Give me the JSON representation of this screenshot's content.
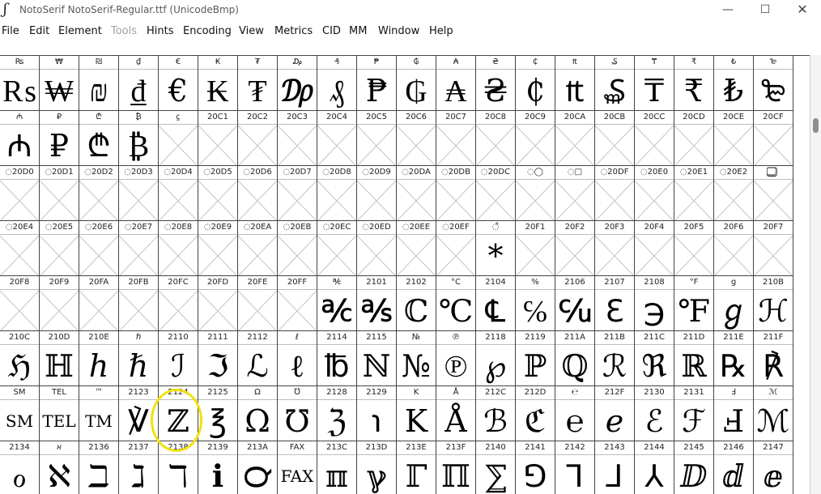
{
  "window": {
    "title": "NotoSerif  NotoSerif-Regular.ttf (UnicodeBmp)",
    "app_icon": "fontforge-icon",
    "minimize": "—",
    "maximize": "☐",
    "close": "✕"
  },
  "menu": [
    {
      "label": "File",
      "enabled": true
    },
    {
      "label": "Edit",
      "enabled": true
    },
    {
      "label": "Element",
      "enabled": true
    },
    {
      "label": "Tools",
      "enabled": false
    },
    {
      "label": "Hints",
      "enabled": true
    },
    {
      "label": "Encoding",
      "enabled": true
    },
    {
      "label": "View",
      "enabled": true
    },
    {
      "label": "Metrics",
      "enabled": true
    },
    {
      "label": "CID",
      "enabled": true
    },
    {
      "label": "MM",
      "enabled": true
    },
    {
      "label": "Window",
      "enabled": true
    },
    {
      "label": "Help",
      "enabled": true
    }
  ],
  "rows": [
    {
      "cells": [
        {
          "label": "₨",
          "glyph": "₨"
        },
        {
          "label": "₩",
          "glyph": "₩"
        },
        {
          "label": "₪",
          "glyph": "₪"
        },
        {
          "label": "₫",
          "glyph": "₫"
        },
        {
          "label": "€",
          "glyph": "€"
        },
        {
          "label": "₭",
          "glyph": "₭"
        },
        {
          "label": "₮",
          "glyph": "₮"
        },
        {
          "label": "₯",
          "glyph": "₯"
        },
        {
          "label": "₰",
          "glyph": "₰"
        },
        {
          "label": "₱",
          "glyph": "₱"
        },
        {
          "label": "₲",
          "glyph": "₲"
        },
        {
          "label": "₳",
          "glyph": "₳"
        },
        {
          "label": "₴",
          "glyph": "₴"
        },
        {
          "label": "₵",
          "glyph": "₵"
        },
        {
          "label": "₶",
          "glyph": "₶"
        },
        {
          "label": "₷",
          "glyph": "₷"
        },
        {
          "label": "₸",
          "glyph": "₸"
        },
        {
          "label": "₹",
          "glyph": "₹"
        },
        {
          "label": "₺",
          "glyph": "₺"
        },
        {
          "label": "₻",
          "glyph": "₻"
        }
      ]
    },
    {
      "cells": [
        {
          "label": "₼",
          "glyph": "₼"
        },
        {
          "label": "₽",
          "glyph": "₽"
        },
        {
          "label": "₾",
          "glyph": "₾"
        },
        {
          "label": "₿",
          "glyph": "₿"
        },
        {
          "label": "⃀",
          "glyph": ""
        },
        {
          "label": "20C1",
          "glyph": ""
        },
        {
          "label": "20C2",
          "glyph": ""
        },
        {
          "label": "20C3",
          "glyph": ""
        },
        {
          "label": "20C4",
          "glyph": ""
        },
        {
          "label": "20C5",
          "glyph": ""
        },
        {
          "label": "20C6",
          "glyph": ""
        },
        {
          "label": "20C7",
          "glyph": ""
        },
        {
          "label": "20C8",
          "glyph": ""
        },
        {
          "label": "20C9",
          "glyph": ""
        },
        {
          "label": "20CA",
          "glyph": ""
        },
        {
          "label": "20CB",
          "glyph": ""
        },
        {
          "label": "20CC",
          "glyph": ""
        },
        {
          "label": "20CD",
          "glyph": ""
        },
        {
          "label": "20CE",
          "glyph": ""
        },
        {
          "label": "20CF",
          "glyph": ""
        }
      ]
    },
    {
      "cells": [
        {
          "label": "◌20D0",
          "glyph": ""
        },
        {
          "label": "◌20D1",
          "glyph": ""
        },
        {
          "label": "◌20D2",
          "glyph": ""
        },
        {
          "label": "◌20D3",
          "glyph": ""
        },
        {
          "label": "◌20D4",
          "glyph": ""
        },
        {
          "label": "◌20D5",
          "glyph": ""
        },
        {
          "label": "◌20D6",
          "glyph": ""
        },
        {
          "label": "◌20D7",
          "glyph": ""
        },
        {
          "label": "◌20D8",
          "glyph": ""
        },
        {
          "label": "◌20D9",
          "glyph": ""
        },
        {
          "label": "◌20DA",
          "glyph": ""
        },
        {
          "label": "◌20DB",
          "glyph": ""
        },
        {
          "label": "◌20DC",
          "glyph": ""
        },
        {
          "label": "◌◯",
          "glyph": ""
        },
        {
          "label": "◌□",
          "glyph": ""
        },
        {
          "label": "◌20DF",
          "glyph": ""
        },
        {
          "label": "◌20E0",
          "glyph": ""
        },
        {
          "label": "◌20E1",
          "glyph": ""
        },
        {
          "label": "◌20E2",
          "glyph": ""
        },
        {
          "label": "⃣",
          "glyph": ""
        }
      ]
    },
    {
      "cells": [
        {
          "label": "◌20E4",
          "glyph": ""
        },
        {
          "label": "◌20E5",
          "glyph": ""
        },
        {
          "label": "◌20E6",
          "glyph": ""
        },
        {
          "label": "◌20E7",
          "glyph": ""
        },
        {
          "label": "◌20E8",
          "glyph": ""
        },
        {
          "label": "◌20E9",
          "glyph": ""
        },
        {
          "label": "◌20EA",
          "glyph": ""
        },
        {
          "label": "◌20EB",
          "glyph": ""
        },
        {
          "label": "◌20EC",
          "glyph": ""
        },
        {
          "label": "◌20ED",
          "glyph": ""
        },
        {
          "label": "◌20EE",
          "glyph": ""
        },
        {
          "label": "◌20EF",
          "glyph": ""
        },
        {
          "label": "◌̊",
          "glyph": "*"
        },
        {
          "label": "20F1",
          "glyph": ""
        },
        {
          "label": "20F2",
          "glyph": ""
        },
        {
          "label": "20F3",
          "glyph": ""
        },
        {
          "label": "20F4",
          "glyph": ""
        },
        {
          "label": "20F5",
          "glyph": ""
        },
        {
          "label": "20F6",
          "glyph": ""
        },
        {
          "label": "20F7",
          "glyph": ""
        }
      ]
    },
    {
      "cells": [
        {
          "label": "20F8",
          "glyph": ""
        },
        {
          "label": "20F9",
          "glyph": ""
        },
        {
          "label": "20FA",
          "glyph": ""
        },
        {
          "label": "20FB",
          "glyph": ""
        },
        {
          "label": "20FC",
          "glyph": ""
        },
        {
          "label": "20FD",
          "glyph": ""
        },
        {
          "label": "20FE",
          "glyph": ""
        },
        {
          "label": "20FF",
          "glyph": ""
        },
        {
          "label": "℀",
          "glyph": "℀"
        },
        {
          "label": "2101",
          "glyph": "℁"
        },
        {
          "label": "2102",
          "glyph": "ℂ"
        },
        {
          "label": "°C",
          "glyph": "℃"
        },
        {
          "label": "2104",
          "glyph": "℄"
        },
        {
          "label": "%",
          "glyph": "℅"
        },
        {
          "label": "2106",
          "glyph": "℆"
        },
        {
          "label": "2107",
          "glyph": "ℇ"
        },
        {
          "label": "2108",
          "glyph": "℈"
        },
        {
          "label": "°F",
          "glyph": "℉"
        },
        {
          "label": "g",
          "glyph": "ℊ"
        },
        {
          "label": "210B",
          "glyph": "ℋ"
        }
      ]
    },
    {
      "cells": [
        {
          "label": "210C",
          "glyph": "ℌ"
        },
        {
          "label": "210D",
          "glyph": "ℍ"
        },
        {
          "label": "210E",
          "glyph": "ℎ"
        },
        {
          "label": "ℏ",
          "glyph": "ℏ"
        },
        {
          "label": "2110",
          "glyph": "ℐ"
        },
        {
          "label": "2111",
          "glyph": "ℑ"
        },
        {
          "label": "2112",
          "glyph": "ℒ"
        },
        {
          "label": "ℓ",
          "glyph": "ℓ"
        },
        {
          "label": "2114",
          "glyph": "℔"
        },
        {
          "label": "2115",
          "glyph": "ℕ"
        },
        {
          "label": "№",
          "glyph": "№"
        },
        {
          "label": "℗",
          "glyph": "℗"
        },
        {
          "label": "2118",
          "glyph": "℘"
        },
        {
          "label": "2119",
          "glyph": "ℙ"
        },
        {
          "label": "211A",
          "glyph": "ℚ"
        },
        {
          "label": "211B",
          "glyph": "ℛ"
        },
        {
          "label": "211C",
          "glyph": "ℜ"
        },
        {
          "label": "211D",
          "glyph": "ℝ"
        },
        {
          "label": "211E",
          "glyph": "℞"
        },
        {
          "label": "211F",
          "glyph": "℟"
        }
      ]
    },
    {
      "cells": [
        {
          "label": "SM",
          "glyph": "SM"
        },
        {
          "label": "TEL",
          "glyph": "TEL"
        },
        {
          "label": "™",
          "glyph": "TM"
        },
        {
          "label": "2123",
          "glyph": "℣"
        },
        {
          "label": "2124",
          "glyph": "ℤ"
        },
        {
          "label": "2125",
          "glyph": "℥"
        },
        {
          "label": "Ω",
          "glyph": "Ω"
        },
        {
          "label": "℧",
          "glyph": "℧"
        },
        {
          "label": "2128",
          "glyph": "ℨ"
        },
        {
          "label": "2129",
          "glyph": "℩"
        },
        {
          "label": "K",
          "glyph": "K"
        },
        {
          "label": "Å",
          "glyph": "Å"
        },
        {
          "label": "212C",
          "glyph": "ℬ"
        },
        {
          "label": "212D",
          "glyph": "ℭ"
        },
        {
          "label": "℮",
          "glyph": "℮"
        },
        {
          "label": "212F",
          "glyph": "ℯ"
        },
        {
          "label": "2130",
          "glyph": "ℰ"
        },
        {
          "label": "2131",
          "glyph": "ℱ"
        },
        {
          "label": "Ⅎ",
          "glyph": "Ⅎ"
        },
        {
          "label": "ℳ",
          "glyph": "ℳ"
        }
      ]
    },
    {
      "cells": [
        {
          "label": "2134",
          "glyph": "ℴ"
        },
        {
          "label": "א",
          "glyph": "ℵ"
        },
        {
          "label": "2136",
          "glyph": "ℶ"
        },
        {
          "label": "2137",
          "glyph": "ℷ"
        },
        {
          "label": "2138",
          "glyph": "ℸ"
        },
        {
          "label": "2139",
          "glyph": "ℹ"
        },
        {
          "label": "213A",
          "glyph": "℺"
        },
        {
          "label": "FAX",
          "glyph": "FAX"
        },
        {
          "label": "213C",
          "glyph": "ℼ"
        },
        {
          "label": "213D",
          "glyph": "ℽ"
        },
        {
          "label": "213E",
          "glyph": "ℾ"
        },
        {
          "label": "213F",
          "glyph": "ℿ"
        },
        {
          "label": "2140",
          "glyph": "⅀"
        },
        {
          "label": "2141",
          "glyph": "⅁"
        },
        {
          "label": "2142",
          "glyph": "⅂"
        },
        {
          "label": "2143",
          "glyph": "⅃"
        },
        {
          "label": "2144",
          "glyph": "⅄"
        },
        {
          "label": "2145",
          "glyph": "ⅅ"
        },
        {
          "label": "2146",
          "glyph": "ⅆ"
        },
        {
          "label": "2147",
          "glyph": "ⅇ"
        }
      ]
    }
  ],
  "selection": {
    "row": 6,
    "col": 4,
    "highlight_color": "#f2e10e"
  }
}
